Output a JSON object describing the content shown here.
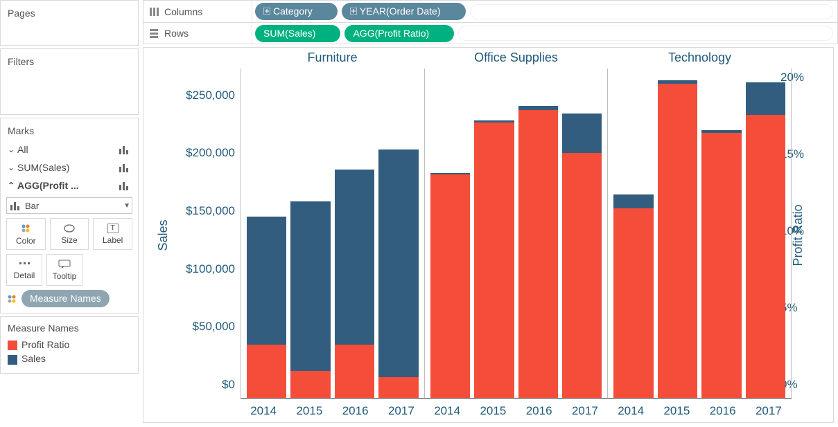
{
  "sidebar": {
    "pages_title": "Pages",
    "filters_title": "Filters",
    "marks_title": "Marks",
    "mark_rows": {
      "all": "All",
      "sum_sales": "SUM(Sales)",
      "agg_profit": "AGG(Profit ..."
    },
    "mark_type": "Bar",
    "cells": {
      "color": "Color",
      "size": "Size",
      "label": "Label",
      "detail": "Detail",
      "tooltip": "Tooltip"
    },
    "measure_names_pill": "Measure Names",
    "legend": {
      "title": "Measure Names",
      "items": [
        {
          "label": "Profit Ratio",
          "color": "#f44e3b"
        },
        {
          "label": "Sales",
          "color": "#335d7e"
        }
      ]
    }
  },
  "shelves": {
    "columns_label": "Columns",
    "rows_label": "Rows",
    "column_pills": [
      "Category",
      "YEAR(Order Date)"
    ],
    "row_pills": [
      "SUM(Sales)",
      "AGG(Profit Ratio)"
    ]
  },
  "chart_data": {
    "type": "bar",
    "title": "",
    "facets": [
      "Furniture",
      "Office Supplies",
      "Technology"
    ],
    "categories": [
      "2014",
      "2015",
      "2016",
      "2017"
    ],
    "series": [
      {
        "name": "Profit Ratio",
        "color": "#f44e3b"
      },
      {
        "name": "Sales",
        "color": "#335d7e"
      }
    ],
    "y_left": {
      "label": "Sales",
      "ticks": [
        "$0",
        "$50,000",
        "$100,000",
        "$150,000",
        "$200,000",
        "$250,000"
      ],
      "range": [
        0,
        285000
      ]
    },
    "y_right": {
      "label": "Profit Ratio",
      "ticks": [
        "0%",
        "5%",
        "10%",
        "15%",
        "20%"
      ],
      "range": [
        0,
        0.215
      ]
    },
    "data": {
      "Furniture": [
        {
          "year": "2014",
          "sales": 157000,
          "profit_ratio": 0.035
        },
        {
          "year": "2015",
          "sales": 170000,
          "profit_ratio": 0.018
        },
        {
          "year": "2016",
          "sales": 198000,
          "profit_ratio": 0.035
        },
        {
          "year": "2017",
          "sales": 215000,
          "profit_ratio": 0.014
        }
      ],
      "Office Supplies": [
        {
          "year": "2014",
          "sales": 195000,
          "profit_ratio": 0.146
        },
        {
          "year": "2015",
          "sales": 240000,
          "profit_ratio": 0.18
        },
        {
          "year": "2016",
          "sales": 253000,
          "profit_ratio": 0.188
        },
        {
          "year": "2017",
          "sales": 246000,
          "profit_ratio": 0.16
        }
      ],
      "Technology": [
        {
          "year": "2014",
          "sales": 176000,
          "profit_ratio": 0.124
        },
        {
          "year": "2015",
          "sales": 275000,
          "profit_ratio": 0.205
        },
        {
          "year": "2016",
          "sales": 232000,
          "profit_ratio": 0.173
        },
        {
          "year": "2017",
          "sales": 273000,
          "profit_ratio": 0.185
        }
      ]
    }
  }
}
